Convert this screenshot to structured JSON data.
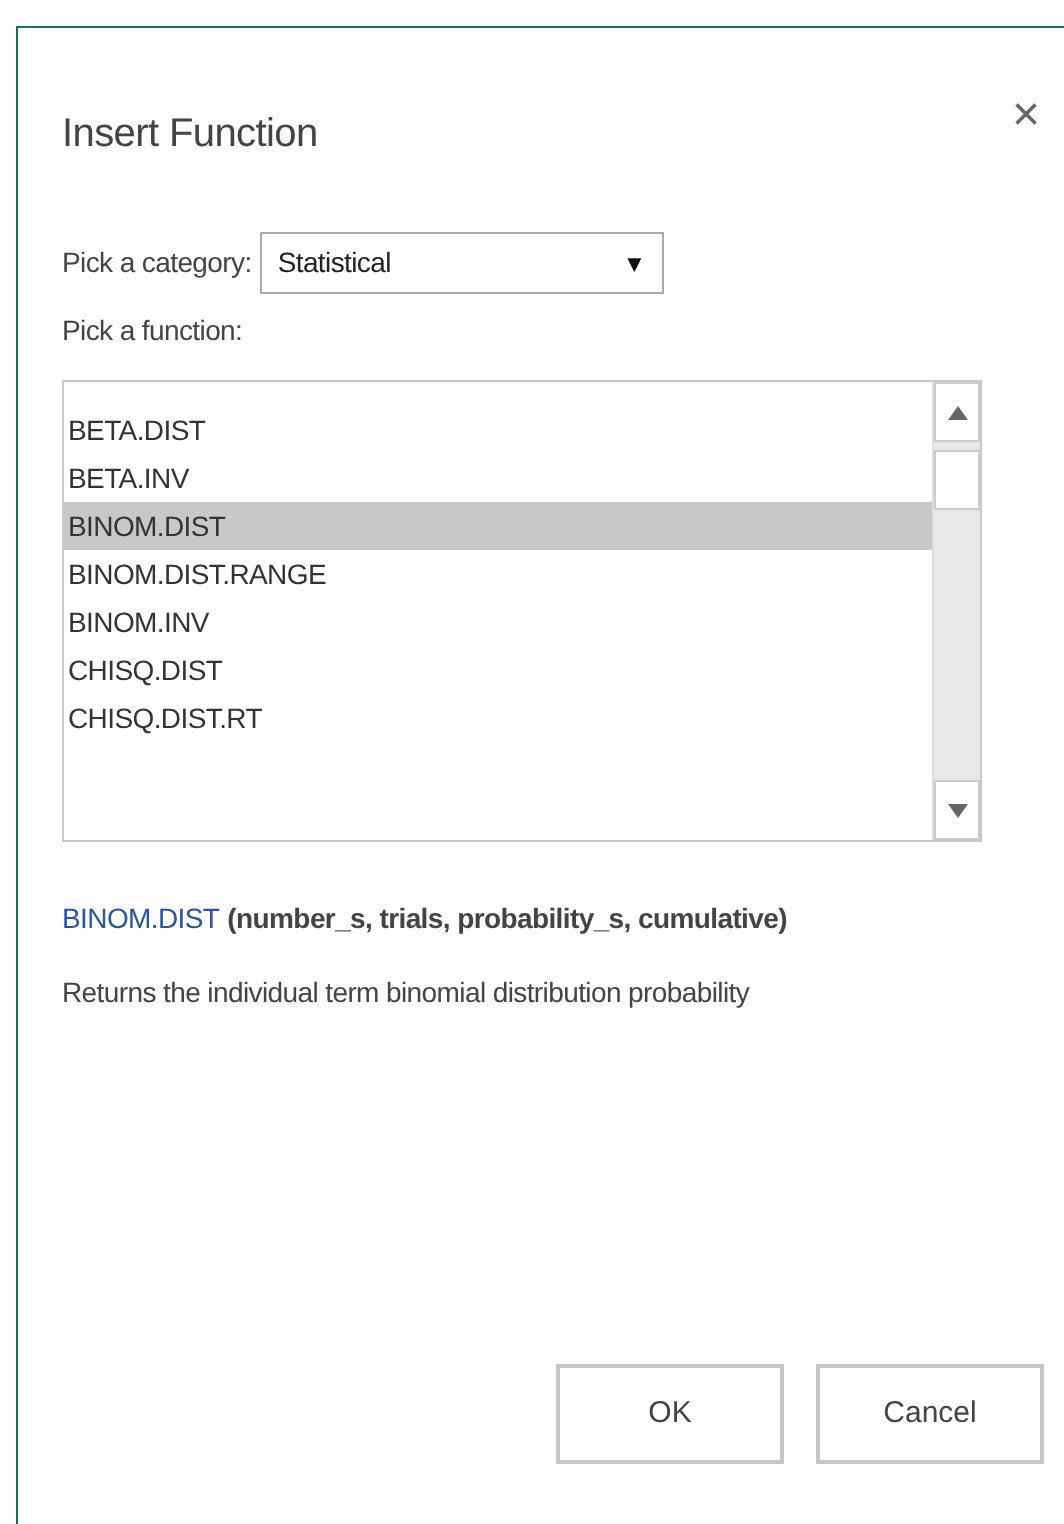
{
  "dialog": {
    "title": "Insert Function",
    "close": "×"
  },
  "category": {
    "label": "Pick a category:",
    "value": "Statistical",
    "caret": "▼"
  },
  "function_label": "Pick a function:",
  "functions": [
    {
      "name": "BETA.DIST",
      "selected": false
    },
    {
      "name": "BETA.INV",
      "selected": false
    },
    {
      "name": "BINOM.DIST",
      "selected": true
    },
    {
      "name": "BINOM.DIST.RANGE",
      "selected": false
    },
    {
      "name": "BINOM.INV",
      "selected": false
    },
    {
      "name": "CHISQ.DIST",
      "selected": false
    },
    {
      "name": "CHISQ.DIST.RT",
      "selected": false
    }
  ],
  "signature": {
    "name": "BINOM.DIST",
    "arguments": "(number_s, trials, probability_s, cumulative)"
  },
  "description": "Returns the individual term binomial distribution probability",
  "buttons": [
    "OK",
    "Cancel"
  ]
}
